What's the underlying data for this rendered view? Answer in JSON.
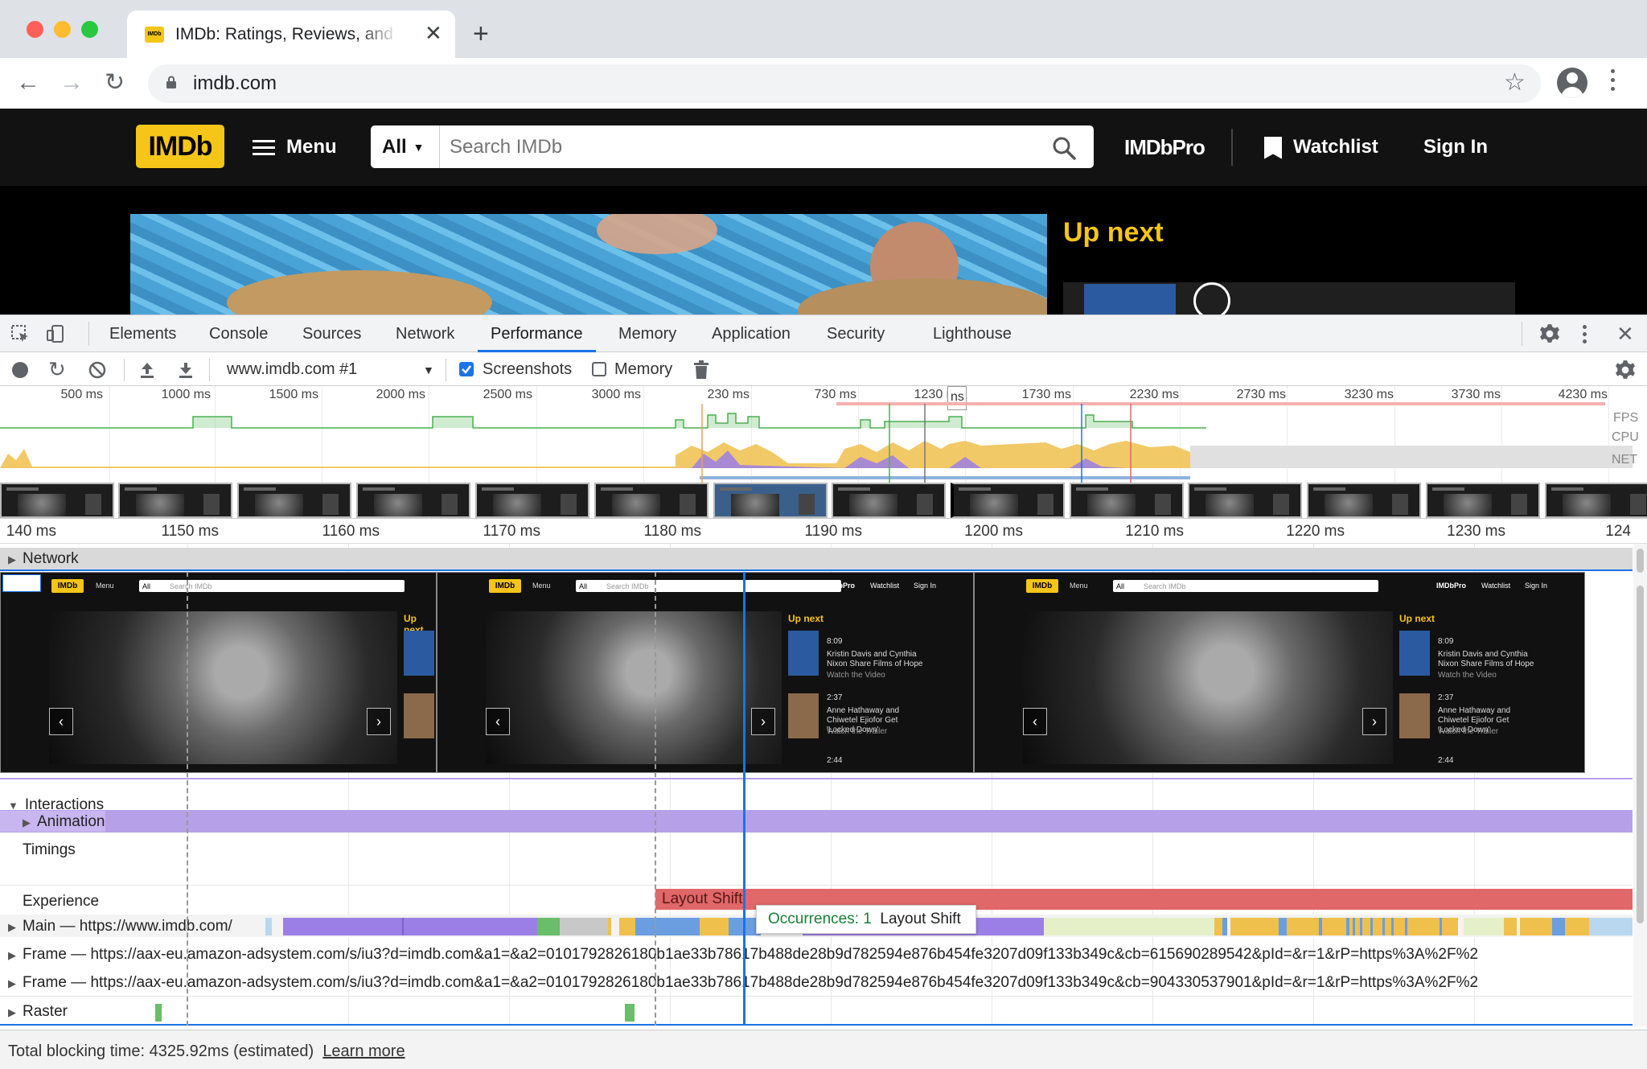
{
  "browser": {
    "tab_title": "IMDb: Ratings, Reviews, and Where to Watch the Best Movies & TV Shows",
    "tab_favicon_text": "IMDb",
    "close_glyph": "✕",
    "newtab_glyph": "+",
    "url": "imdb.com",
    "back_glyph": "←",
    "forward_glyph": "→",
    "reload_glyph": "↻",
    "star_glyph": "☆"
  },
  "imdb": {
    "logo": "IMDb",
    "menu_label": "Menu",
    "search_category": "All",
    "search_placeholder": "Search IMDb",
    "imdbpro": "IMDbPro",
    "watchlist": "Watchlist",
    "signin": "Sign In",
    "up_next": "Up next"
  },
  "devtools": {
    "tabs": [
      "Elements",
      "Console",
      "Sources",
      "Network",
      "Performance",
      "Memory",
      "Application",
      "Security",
      "Lighthouse"
    ],
    "active_tab": "Performance",
    "profile_select": "www.imdb.com #1",
    "screenshots_label": "Screenshots",
    "screenshots_checked": true,
    "memory_label": "Memory",
    "memory_checked": false,
    "overview_ticks": [
      "500 ms",
      "1000 ms",
      "1500 ms",
      "2000 ms",
      "2500 ms",
      "3000 ms",
      "230 ms",
      "730 ms",
      "1230 ms",
      "1730 ms",
      "2230 ms",
      "2730 ms",
      "3230 ms",
      "3730 ms",
      "4230 ms"
    ],
    "overview_labels": [
      "FPS",
      "CPU",
      "NET"
    ],
    "ruler_ticks": [
      "140 ms",
      "1150 ms",
      "1160 ms",
      "1170 ms",
      "1180 ms",
      "1190 ms",
      "1200 ms",
      "1210 ms",
      "1220 ms",
      "1230 ms",
      "124"
    ],
    "tracks": {
      "network": "Network",
      "interactions": "Interactions",
      "animation": "Animation",
      "timings": "Timings",
      "experience": "Experience",
      "main": "Main — https://www.imdb.com/",
      "frame1": "Frame — https://aax-eu.amazon-adsystem.com/s/iu3?d=imdb.com&a1=&a2=0101792826180b1ae33b78617b488de28b9d782594e876b454fe3207d09f133b349c&cb=615690289542&pId=&r=1&rP=https%3A%2F%2",
      "frame2": "Frame — https://aax-eu.amazon-adsystem.com/s/iu3?d=imdb.com&a1=&a2=0101792826180b1ae33b78617b488de28b9d782594e876b454fe3207d09f133b349c&cb=904330537901&pId=&r=1&rP=https%3A%2F%2",
      "raster": "Raster"
    },
    "layout_shift_label": "Layout Shift",
    "tooltip_occurrences": "Occurrences: 1",
    "tooltip_label": "Layout Shift",
    "status_text": "Total blocking time: 4325.92ms (estimated)",
    "learn_more": "Learn more",
    "shot_text": {
      "menu": "Menu",
      "all": "All",
      "search": "Search IMDb",
      "imdbpro": "IMDbPro",
      "watchlist": "Watchlist",
      "signin": "Sign In",
      "upnext": "Up next",
      "dur1": "8:09",
      "item1": "Kristin Davis and Cynthia Nixon Share Films of Hope",
      "item1_sub": "Watch the Video",
      "dur2": "2:37",
      "item2": "Anne Hathaway and Chiwetel Ejiofor Get 'Locked Down'",
      "item2_sub": "Watch the Trailer",
      "dur3": "2:44"
    }
  },
  "colors": {
    "imdb_yellow": "#f5c518",
    "devtools_blue": "#1a73e8",
    "layout_shift_red": "#e06868",
    "animation_purple": "#b6a1e8",
    "scripting_yellow": "#f0c04c",
    "rendering_purple": "#9b7fe6"
  }
}
